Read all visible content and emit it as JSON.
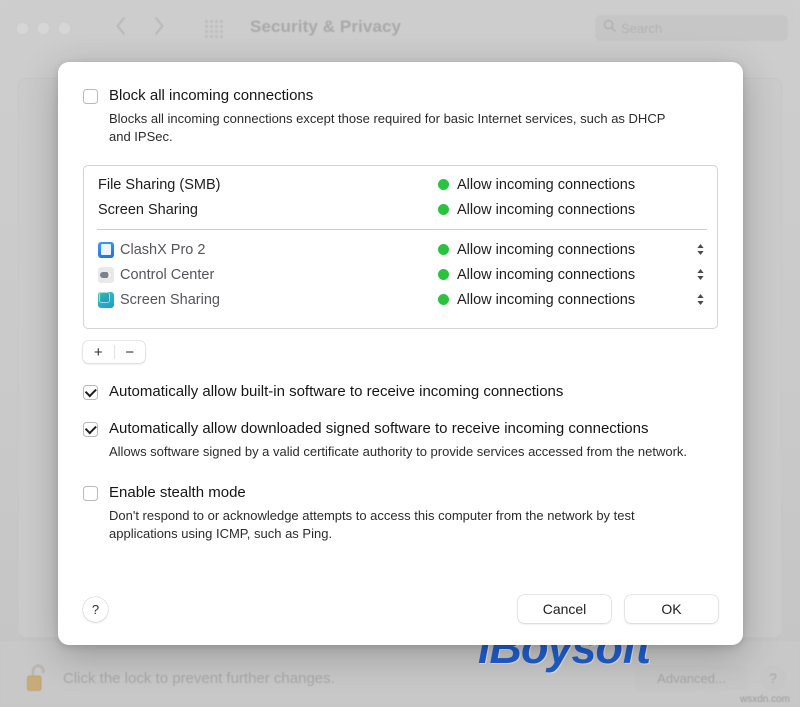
{
  "window": {
    "title": "Security & Privacy",
    "search_placeholder": "Search",
    "lock_text": "Click the lock to prevent further changes.",
    "advanced_label": "Advanced...",
    "help_label": "?",
    "watermark": "iBoysoft",
    "site_credit": "wsxdn.com"
  },
  "dialog": {
    "block_all": {
      "label": "Block all incoming connections",
      "checked": false,
      "description": "Blocks all incoming connections except those required for basic Internet services, such as DHCP and IPSec."
    },
    "list": {
      "services": [
        {
          "name": "File Sharing (SMB)",
          "status": "Allow incoming connections",
          "status_color": "#2ac33f"
        },
        {
          "name": "Screen Sharing",
          "status": "Allow incoming connections",
          "status_color": "#2ac33f"
        }
      ],
      "apps": [
        {
          "name": "ClashX Pro 2",
          "icon": "clashx-app-icon",
          "status": "Allow incoming connections",
          "status_color": "#2ac33f"
        },
        {
          "name": "Control Center",
          "icon": "control-center-app-icon",
          "status": "Allow incoming connections",
          "status_color": "#2ac33f"
        },
        {
          "name": "Screen Sharing",
          "icon": "screen-sharing-app-icon",
          "status": "Allow incoming connections",
          "status_color": "#2ac33f"
        }
      ]
    },
    "add_label": "+",
    "remove_label": "−",
    "builtin": {
      "label": "Automatically allow built-in software to receive incoming connections",
      "checked": true
    },
    "signed": {
      "label": "Automatically allow downloaded signed software to receive incoming connections",
      "checked": true,
      "description": "Allows software signed by a valid certificate authority to provide services accessed from the network."
    },
    "stealth": {
      "label": "Enable stealth mode",
      "checked": false,
      "description": "Don't respond to or acknowledge attempts to access this computer from the network by test applications using ICMP, such as Ping."
    },
    "help_label": "?",
    "cancel_label": "Cancel",
    "ok_label": "OK"
  }
}
